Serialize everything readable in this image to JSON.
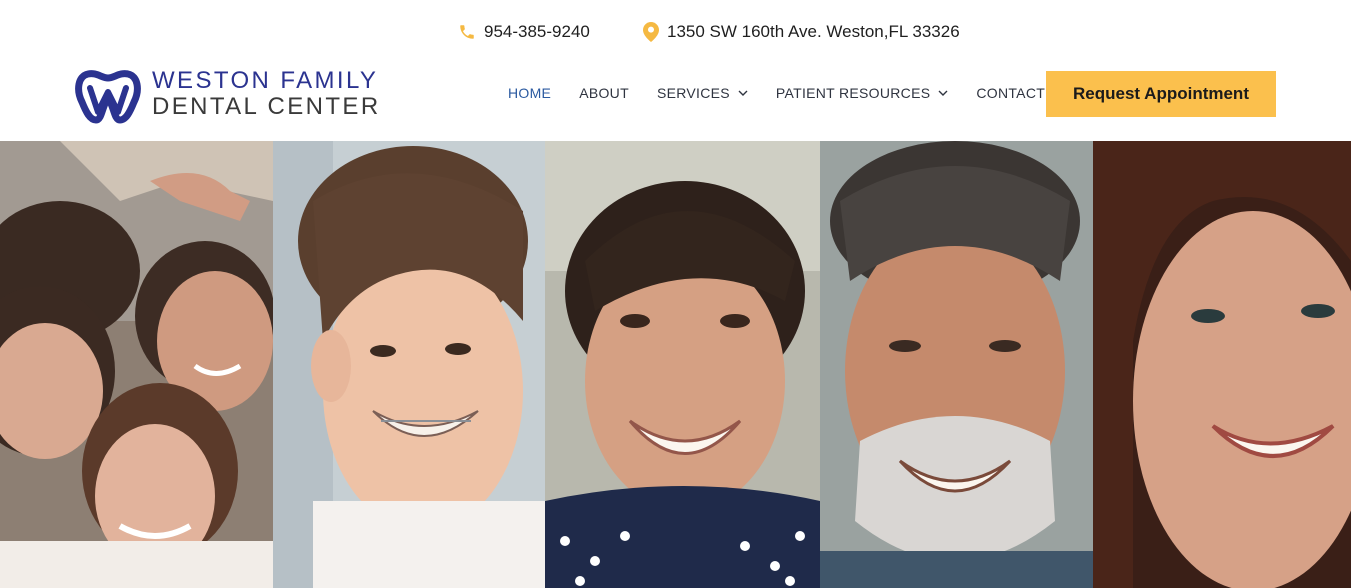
{
  "topbar": {
    "phone": "954-385-9240",
    "address": "1350 SW 160th Ave. Weston,FL 33326",
    "icon_color": "#f5b942"
  },
  "logo": {
    "line1": "WESTON FAMILY",
    "line2": "DENTAL CENTER",
    "brand_color": "#2b3390"
  },
  "nav": {
    "items": [
      {
        "label": "HOME",
        "active": true,
        "dropdown": false
      },
      {
        "label": "ABOUT",
        "active": false,
        "dropdown": false
      },
      {
        "label": "SERVICES",
        "active": false,
        "dropdown": true
      },
      {
        "label": "PATIENT RESOURCES",
        "active": false,
        "dropdown": true
      },
      {
        "label": "CONTACT",
        "active": false,
        "dropdown": false
      }
    ]
  },
  "cta": {
    "label": "Request Appointment",
    "color": "#fbc04d"
  },
  "hero": {
    "panels": [
      "family-photo",
      "teen-with-braces-photo",
      "young-woman-photo",
      "older-man-photo",
      "woman-smiling-photo"
    ]
  }
}
